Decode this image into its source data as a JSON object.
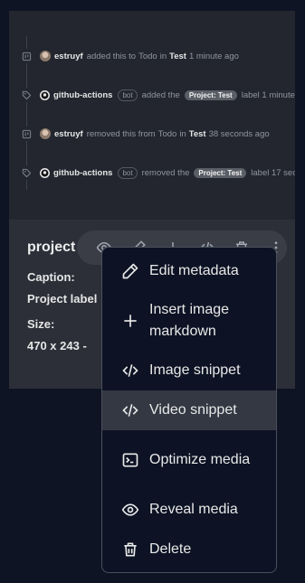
{
  "preview": {
    "events": [
      {
        "user": "estruyf",
        "action": "added this to",
        "from": "Todo",
        "in_word": "in",
        "project": "Test",
        "time": "1 minute ago"
      },
      {
        "user": "github-actions",
        "bot_badge": "bot",
        "action": "added the",
        "label": "Project: Test",
        "suffix": "label 1 minute"
      },
      {
        "user": "estruyf",
        "action": "removed this from",
        "from": "Todo",
        "in_word": "in",
        "project": "Test",
        "time": "38 seconds ago"
      },
      {
        "user": "github-actions",
        "bot_badge": "bot",
        "action": "removed the",
        "label": "Project: Test",
        "suffix": "label 17 sec"
      }
    ]
  },
  "card": {
    "title": "project",
    "caption_label": "Caption:",
    "caption_value": "Project label",
    "size_label": "Size:",
    "size_value": "470 x 243 -"
  },
  "toolbar": {
    "icons": [
      "eye-icon",
      "pencil-icon",
      "insert-icon",
      "code-icon",
      "trash-icon",
      "more-vertical-icon"
    ]
  },
  "menu": {
    "items": [
      {
        "label": "Edit metadata",
        "icon": "pencil-icon"
      },
      {
        "label": "Insert image markdown",
        "icon": "plus-icon"
      },
      {
        "label": "Image snippet",
        "icon": "code-icon"
      },
      {
        "label": "Video snippet",
        "icon": "code-icon",
        "highlighted": true
      },
      {
        "label": "Optimize media",
        "icon": "terminal-icon"
      },
      {
        "label": "Reveal media",
        "icon": "eye-icon"
      },
      {
        "label": "Delete",
        "icon": "trash-icon"
      }
    ]
  }
}
